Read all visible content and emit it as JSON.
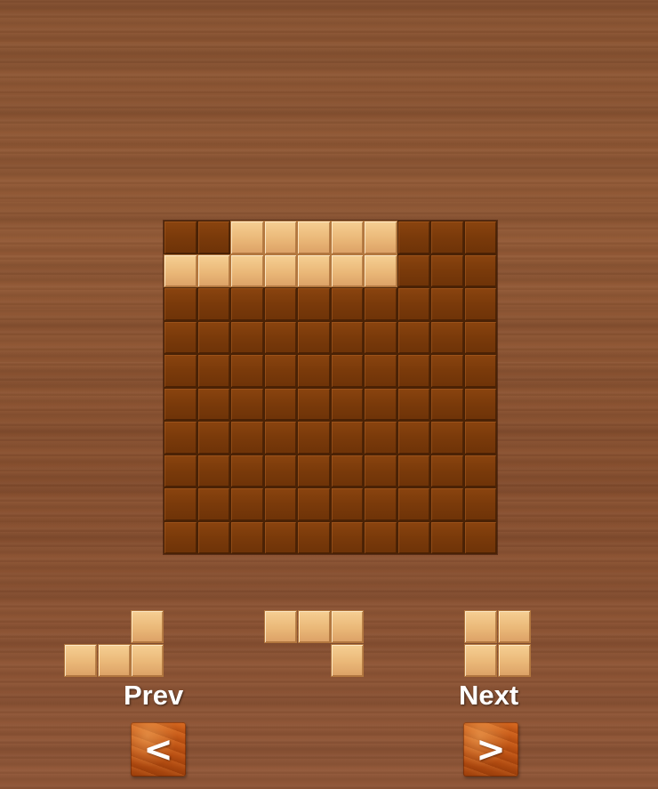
{
  "board": {
    "rows": 10,
    "cols": 10,
    "filled_cells": [
      [
        0,
        2
      ],
      [
        0,
        3
      ],
      [
        0,
        4
      ],
      [
        0,
        5
      ],
      [
        0,
        6
      ],
      [
        1,
        0
      ],
      [
        1,
        1
      ],
      [
        1,
        2
      ],
      [
        1,
        3
      ],
      [
        1,
        4
      ],
      [
        1,
        5
      ],
      [
        1,
        6
      ]
    ]
  },
  "pieces": [
    {
      "name": "piece-l-shape",
      "cells": [
        [
          0,
          2
        ],
        [
          1,
          0
        ],
        [
          1,
          1
        ],
        [
          1,
          2
        ]
      ]
    },
    {
      "name": "piece-corner-shape",
      "cells": [
        [
          0,
          0
        ],
        [
          0,
          1
        ],
        [
          0,
          2
        ],
        [
          1,
          2
        ]
      ]
    },
    {
      "name": "piece-square-shape",
      "cells": [
        [
          0,
          0
        ],
        [
          0,
          1
        ],
        [
          1,
          0
        ],
        [
          1,
          1
        ]
      ]
    }
  ],
  "controls": {
    "prev_label": "Prev",
    "next_label": "Next",
    "prev_button_glyph": "<",
    "next_button_glyph": ">",
    "prev_icon": "chevron-left-icon",
    "next_icon": "chevron-right-icon"
  },
  "colors": {
    "board_cell": "#7a3a0a",
    "filled_tile": "#eab878",
    "nav_button": "#b94f12",
    "label_text": "#ffffff"
  }
}
